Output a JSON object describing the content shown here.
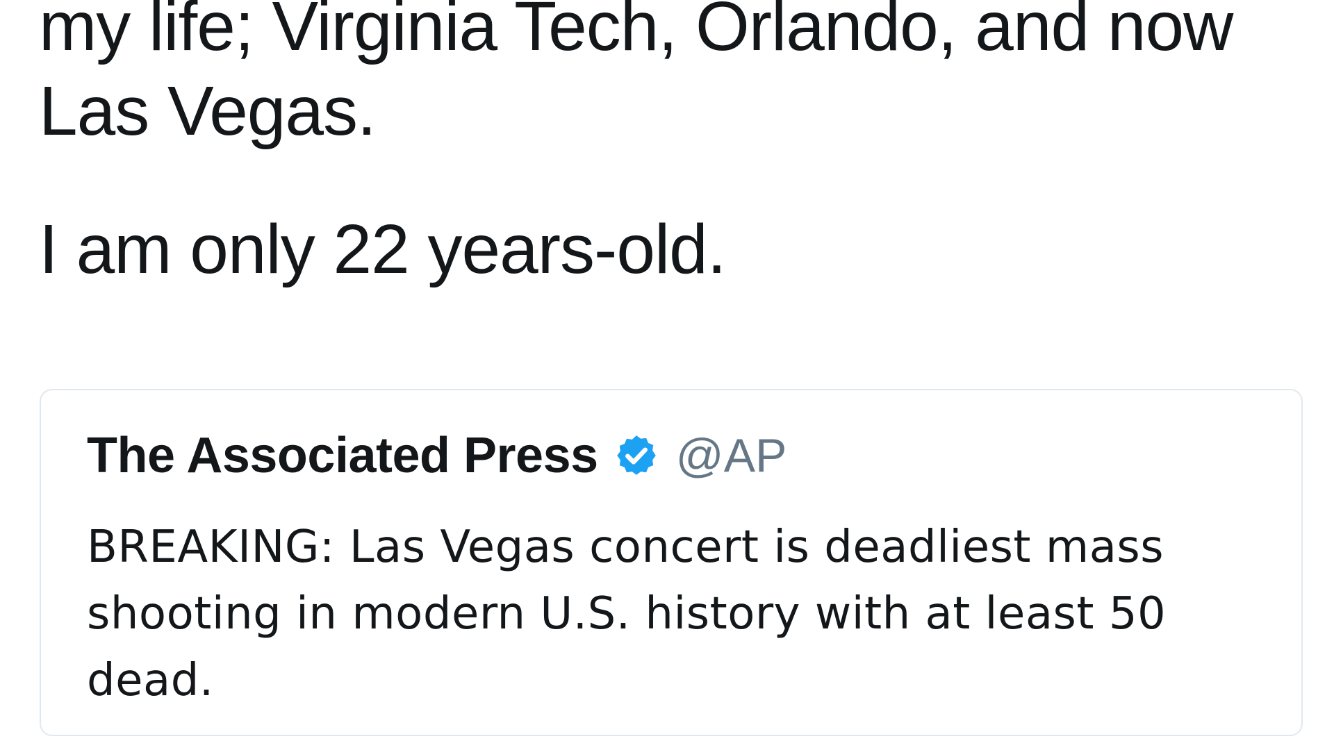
{
  "tweet": {
    "lines": [
      "my life; Virginia Tech, Orlando, and now",
      "Las Vegas.",
      "I am only 22 years-old."
    ]
  },
  "quoted_tweet": {
    "author_name": "The Associated Press",
    "handle": "@AP",
    "verified_icon": "verified-badge-icon",
    "text": "BREAKING: Las Vegas concert is deadliest mass shooting in modern U.S. history with at least 50 dead."
  },
  "colors": {
    "verified_blue": "#1da1f2",
    "handle_gray": "#657786",
    "text": "#14171a",
    "card_border": "#e1e8ed"
  }
}
